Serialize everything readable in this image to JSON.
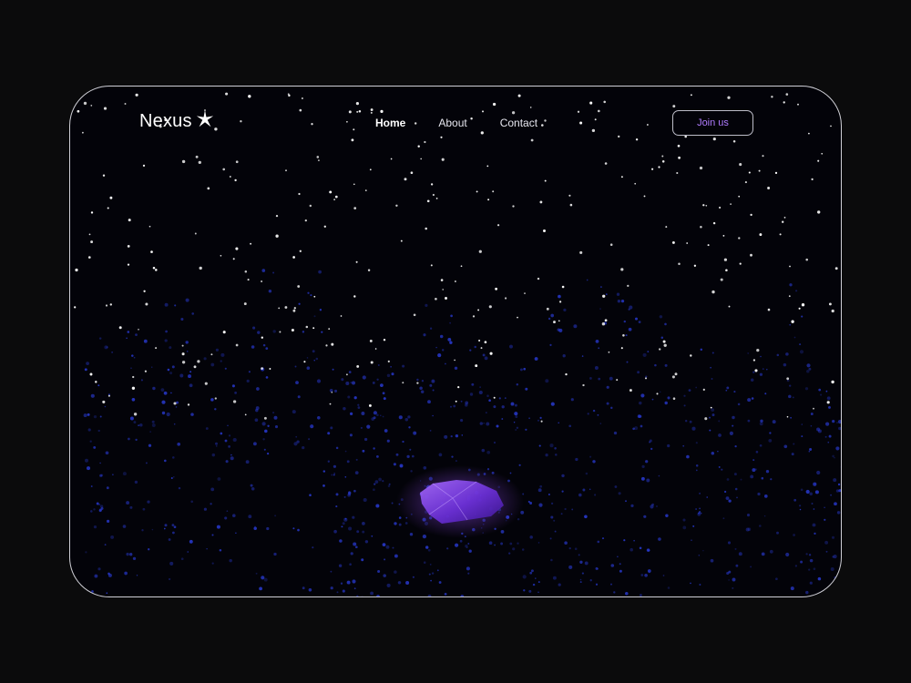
{
  "header": {
    "brand": "Nexus",
    "nav_items": [
      {
        "label": "Home",
        "active": true
      },
      {
        "label": "About",
        "active": false
      },
      {
        "label": "Contact",
        "active": false
      }
    ],
    "cta_label": "Join us"
  },
  "hero": {
    "visual": "starry-night-sky-with-blue-particle-columns-and-purple-crystal"
  },
  "colors": {
    "background": "#0b0b0c",
    "frame_border": "#cfcfd6",
    "canvas": "#030309",
    "accent_purple": "#b07cff",
    "particle_blue": "#2a3cd8",
    "star_white": "#ffffff"
  }
}
